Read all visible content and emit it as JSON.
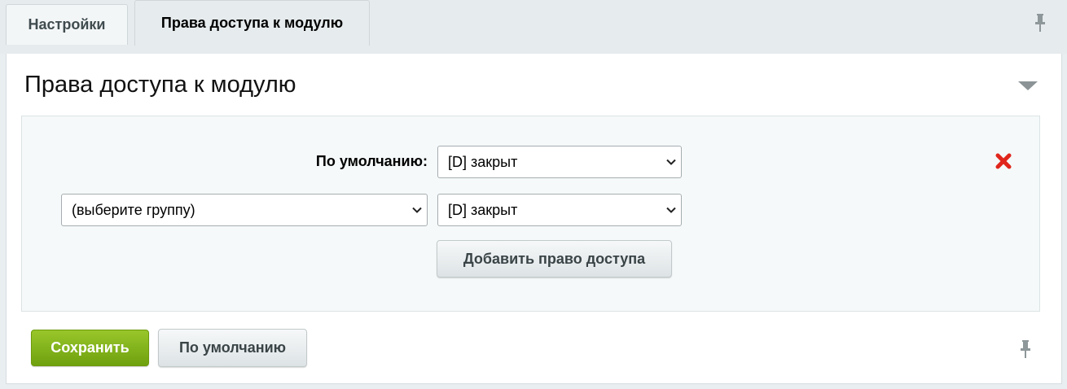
{
  "tabs": [
    {
      "label": "Настройки",
      "active": false
    },
    {
      "label": "Права доступа к модулю",
      "active": true
    }
  ],
  "section": {
    "title": "Права доступа к модулю"
  },
  "form": {
    "default_label": "По умолчанию:",
    "default_select_value": "[D] закрыт",
    "group_select_value": "(выберите группу)",
    "group_right_value": "[D] закрыт",
    "add_button": "Добавить право доступа"
  },
  "footer": {
    "save_button": "Сохранить",
    "default_button": "По умолчанию"
  },
  "colors": {
    "accent_green": "#7eb01a",
    "delete_red": "#e0261c"
  },
  "icons": [
    "pin-icon",
    "collapse-arrow-icon",
    "delete-icon",
    "chevron-down-icon"
  ]
}
